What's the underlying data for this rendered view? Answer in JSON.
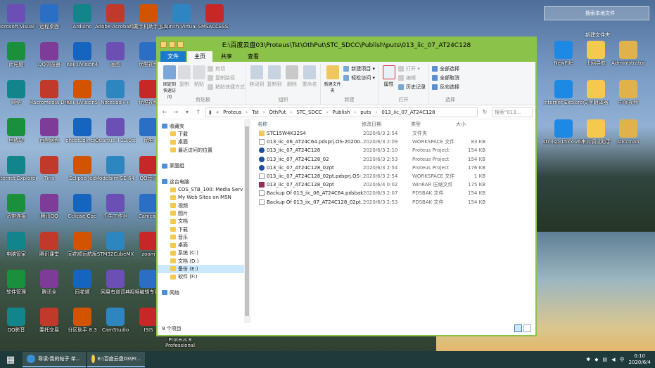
{
  "window": {
    "title": "E:\\百度云盘03\\Proteus\\Tst\\OthPut\\STC_SDCC\\Publish\\puts\\013_iic_07_AT24C128",
    "tabs": [
      "文件",
      "主页",
      "共享",
      "查看"
    ],
    "ribbon": {
      "clipboard": {
        "name": "剪贴板",
        "pin": "固定到快速访问",
        "copy": "复制",
        "paste": "粘贴",
        "cut": "剪切",
        "copy_path": "复制路径",
        "paste_shortcut": "粘贴快捷方式"
      },
      "organize": {
        "name": "组织",
        "move_to": "移动到",
        "copy_to": "复制到",
        "delete": "删除",
        "rename": "重命名"
      },
      "new": {
        "name": "新建",
        "new_folder": "新建文件夹",
        "new_item": "新建项目 ▾",
        "easy_access": "轻松访问 ▾"
      },
      "open": {
        "name": "打开",
        "properties": "属性",
        "open": "打开 ▾",
        "edit": "编辑",
        "history": "历史记录"
      },
      "select": {
        "name": "选择",
        "select_all": "全部选择",
        "select_none": "全部取消",
        "invert": "反向选择"
      }
    },
    "breadcrumb": [
      "Proteus",
      "Tst",
      "OthPut",
      "STC_SDCC",
      "Publish",
      "puts",
      "013_iic_07_AT24C128"
    ],
    "search_placeholder": "搜索\"013...",
    "columns": {
      "name": "名称",
      "date": "修改日期",
      "type": "类型",
      "size": "大小"
    },
    "files": [
      {
        "name": "STC15W4K32S4",
        "date": "2020/6/3 2:54",
        "type": "文件夹",
        "size": "",
        "icon": "folder"
      },
      {
        "name": "013_iic_06_AT24C64.pdsprj.OS-20200...",
        "date": "2020/6/3 2:09",
        "type": "WORKSPACE 文件",
        "size": "83 KB",
        "icon": "doc"
      },
      {
        "name": "013_iic_07_AT24C128",
        "date": "2020/6/3 2:10",
        "type": "Proteus Project",
        "size": "154 KB",
        "icon": "proteus"
      },
      {
        "name": "013_iic_07_AT24C128_02",
        "date": "2020/6/3 2:53",
        "type": "Proteus Project",
        "size": "154 KB",
        "icon": "proteus"
      },
      {
        "name": "013_iic_07_AT24C128_02pt",
        "date": "2020/6/3 2:54",
        "type": "Proteus Project",
        "size": "176 KB",
        "icon": "proteus"
      },
      {
        "name": "013_iic_07_AT24C128_02pt.pdsprj.OS-...",
        "date": "2020/6/3 2:54",
        "type": "WORKSPACE 文件",
        "size": "1 KB",
        "icon": "doc"
      },
      {
        "name": "013_iic_07_AT24C128_02pt",
        "date": "2020/6/4 0:02",
        "type": "WinRAR 压缩文件",
        "size": "175 KB",
        "icon": "rar"
      },
      {
        "name": "Backup Of 013_iic_06_AT24C64.pdsbak",
        "date": "2020/6/3 2:07",
        "type": "PDSBAK 文件",
        "size": "154 KB",
        "icon": "doc"
      },
      {
        "name": "Backup Of 013_iic_07_AT24C128_02pt...",
        "date": "2020/6/3 2:53",
        "type": "PDSBAK 文件",
        "size": "154 KB",
        "icon": "doc"
      }
    ],
    "nav": [
      {
        "label": "收藏夹",
        "indent": 1
      },
      {
        "label": "下载",
        "indent": 2
      },
      {
        "label": "桌面",
        "indent": 2
      },
      {
        "label": "最近访问的位置",
        "indent": 2
      },
      {
        "label": "",
        "indent": 0
      },
      {
        "label": "家庭组",
        "indent": 1
      },
      {
        "label": "",
        "indent": 0
      },
      {
        "label": "这台电脑",
        "indent": 1
      },
      {
        "label": "COS_STB_100: Media Serv",
        "indent": 2
      },
      {
        "label": "My Web Sites on MSN",
        "indent": 2
      },
      {
        "label": "视频",
        "indent": 2
      },
      {
        "label": "图片",
        "indent": 2
      },
      {
        "label": "文档",
        "indent": 2
      },
      {
        "label": "下载",
        "indent": 2
      },
      {
        "label": "音乐",
        "indent": 2
      },
      {
        "label": "桌面",
        "indent": 2
      },
      {
        "label": "系统 (C:)",
        "indent": 2
      },
      {
        "label": "文档 (D:)",
        "indent": 2
      },
      {
        "label": "备份 (E:)",
        "indent": 2,
        "selected": true
      },
      {
        "label": "软件 (F:)",
        "indent": 2
      },
      {
        "label": "",
        "indent": 0
      },
      {
        "label": "网络",
        "indent": 1
      }
    ],
    "status": "9 个项目"
  },
  "desktop": {
    "search_gadget": "搜索本地文件",
    "new_folder": "新建文件夹",
    "left_icons": [
      [
        "Microsoft Visual Studio...",
        "远程桌面",
        "Arduino",
        "Adobe Acrobat DC",
        "鸿蒙手机助手工具",
        "Launch Virtual Serial Po...",
        "MSACCESS"
      ],
      [
        "此电脑",
        "QQ浏览器",
        "Keil uVision4",
        "画图",
        "优酷视频"
      ],
      [
        "网络",
        "Macromedia Dreamwea...",
        "Keil uVision5",
        "Notepad++",
        "优酷视频"
      ],
      [
        "回收站",
        "百度网盘",
        "phpstudy_pro",
        "Quartus II 13.0sp1 (64...",
        "优酷"
      ],
      [
        "Internet Explorer",
        "Tina",
        "Eclipse Jee",
        "Modelsim SE-64 10.4",
        "QQ音乐"
      ],
      [
        "宽带连接",
        "腾讯QQ",
        "Eclipse Cpp",
        "千牛工作台",
        "Camcap"
      ],
      [
        "电脑管家",
        "腾讯课堂",
        "同花顺远航版",
        "STM32CubeMX",
        "zoom"
      ],
      [
        "软件管理",
        "腾讯全",
        "同花顺",
        "网易有道词典",
        "视频编辑专家9.3"
      ],
      [
        "QQ影音",
        "委托交易",
        "分区助手 8.3",
        "CamStudio",
        "ISIS"
      ]
    ],
    "right_icons": [
      [
        "NewFile",
        "上网导航",
        "Administrator"
      ],
      [
        "Internet Explorer",
        "文字翻译器",
        "中间视频"
      ],
      [
        "stc-isp-15xx-v6.87E",
        "串口调试助手",
        "sdccman"
      ]
    ],
    "partial_label": "Proteus 8 Professional"
  },
  "taskbar": {
    "tasks": [
      {
        "label": "导读-我的帖子 单...",
        "color": "#3a8fd6"
      },
      {
        "label": "E:\\百度云盘03\\Pr...",
        "color": "#f3c94e"
      }
    ],
    "tray_lang": "中",
    "time": "0:10",
    "date": "2020/6/4"
  }
}
